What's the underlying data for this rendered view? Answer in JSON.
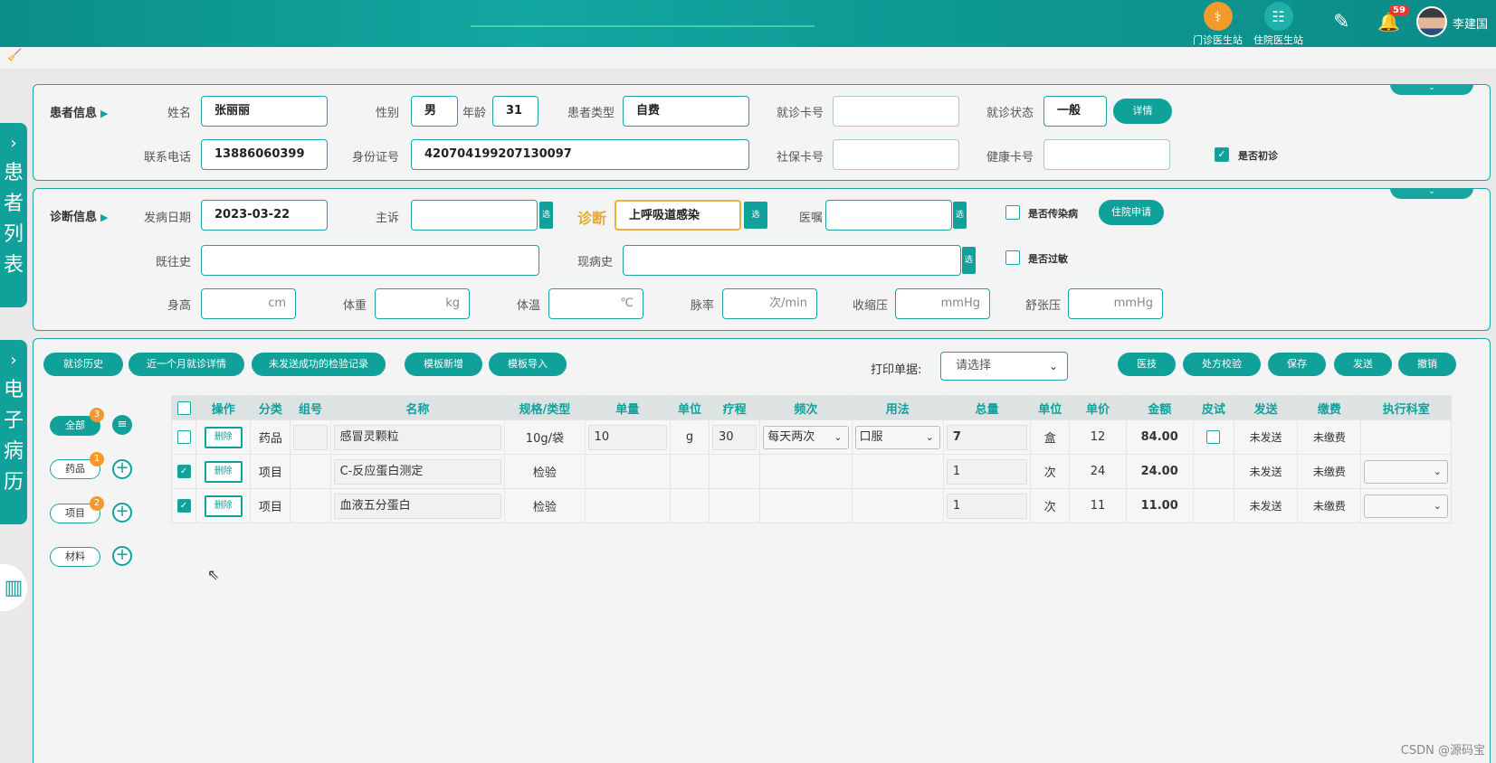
{
  "header": {
    "stations": [
      {
        "label": "门诊医生站",
        "icon": "doctor-icon",
        "color": "#f39a2b"
      },
      {
        "label": "住院医生站",
        "icon": "inpatient-icon",
        "color": "#1fb0a9"
      }
    ],
    "notif_count": "59",
    "user_name": "李建国"
  },
  "side": {
    "patient_list": [
      "患",
      "者",
      "列",
      "表"
    ],
    "emr": [
      "电",
      "子",
      "病",
      "历"
    ]
  },
  "patient": {
    "section_title": "患者信息",
    "name_label": "姓名",
    "name": "张丽丽",
    "gender_label": "性别",
    "gender": "男",
    "age_label": "年龄",
    "age": "31",
    "type_label": "患者类型",
    "type": "自费",
    "card_label": "就诊卡号",
    "card": "",
    "status_label": "就诊状态",
    "status": "一般",
    "detail_btn": "详情",
    "phone_label": "联系电话",
    "phone": "13886060399",
    "id_label": "身份证号",
    "id_no": "420704199207130097",
    "social_label": "社保卡号",
    "social": "",
    "health_label": "健康卡号",
    "health": "",
    "first_visit_label": "是否初诊"
  },
  "diagnosis": {
    "section_title": "诊断信息",
    "onset_label": "发病日期",
    "onset": "2023-03-22",
    "complaint_label": "主诉",
    "complaint": "",
    "diag_label": "诊断",
    "diag": "上呼吸道感染",
    "advice_label": "医嘱",
    "advice": "",
    "select_btn": "选",
    "infectious_label": "是否传染病",
    "admit_btn": "住院申请",
    "past_label": "既往史",
    "past": "",
    "present_label": "现病史",
    "present": "",
    "allergy_label": "是否过敏",
    "height_label": "身高",
    "height_unit": "cm",
    "weight_label": "体重",
    "weight_unit": "kg",
    "temp_label": "体温",
    "temp_unit": "℃",
    "pulse_label": "脉率",
    "pulse_unit": "次/min",
    "sys_label": "收缩压",
    "sys_unit": "mmHg",
    "dia_label": "舒张压",
    "dia_unit": "mmHg"
  },
  "actions": {
    "history": "就诊历史",
    "recent": "近一个月就诊详情",
    "unsent": "未发送成功的检验记录",
    "tpl_new": "模板新增",
    "tpl_import": "模板导入",
    "print_label": "打印单据:",
    "print_placeholder": "请选择",
    "rx_btn": "医技",
    "check_btn": "处方校验",
    "save_btn": "保存",
    "send_btn": "发送",
    "revoke_btn": "撤销"
  },
  "categories": {
    "all": "全部",
    "all_count": "3",
    "drug": "药品",
    "drug_count": "1",
    "item": "项目",
    "item_count": "2",
    "material": "材料"
  },
  "table": {
    "headers": [
      "操作",
      "分类",
      "组号",
      "名称",
      "规格/类型",
      "单量",
      "单位",
      "疗程",
      "频次",
      "用法",
      "总量",
      "单位",
      "单价",
      "金额",
      "皮试",
      "发送",
      "缴费",
      "执行科室"
    ],
    "delete_label": "删除",
    "rows": [
      {
        "checked": false,
        "category": "药品",
        "group": "",
        "name": "感冒灵颗粒",
        "spec": "10g/袋",
        "dose": "10",
        "unit": "g",
        "course": "30",
        "freq": "每天两次",
        "usage": "口服",
        "total": "7",
        "total_unit": "盒",
        "price": "12",
        "amount": "84.00",
        "send": "未发送",
        "pay": "未缴费",
        "dept": ""
      },
      {
        "checked": true,
        "category": "项目",
        "group": "",
        "name": "C-反应蛋白测定",
        "spec": "检验",
        "dose": "",
        "unit": "",
        "course": "",
        "freq": "",
        "usage": "",
        "total": "1",
        "total_unit": "次",
        "price": "24",
        "amount": "24.00",
        "send": "未发送",
        "pay": "未缴费",
        "dept": ""
      },
      {
        "checked": true,
        "category": "项目",
        "group": "",
        "name": "血液五分蛋白",
        "spec": "检验",
        "dose": "",
        "unit": "",
        "course": "",
        "freq": "",
        "usage": "",
        "total": "1",
        "total_unit": "次",
        "price": "11",
        "amount": "11.00",
        "send": "未发送",
        "pay": "未缴费",
        "dept": ""
      }
    ]
  },
  "watermark": "CSDN @源码宝"
}
